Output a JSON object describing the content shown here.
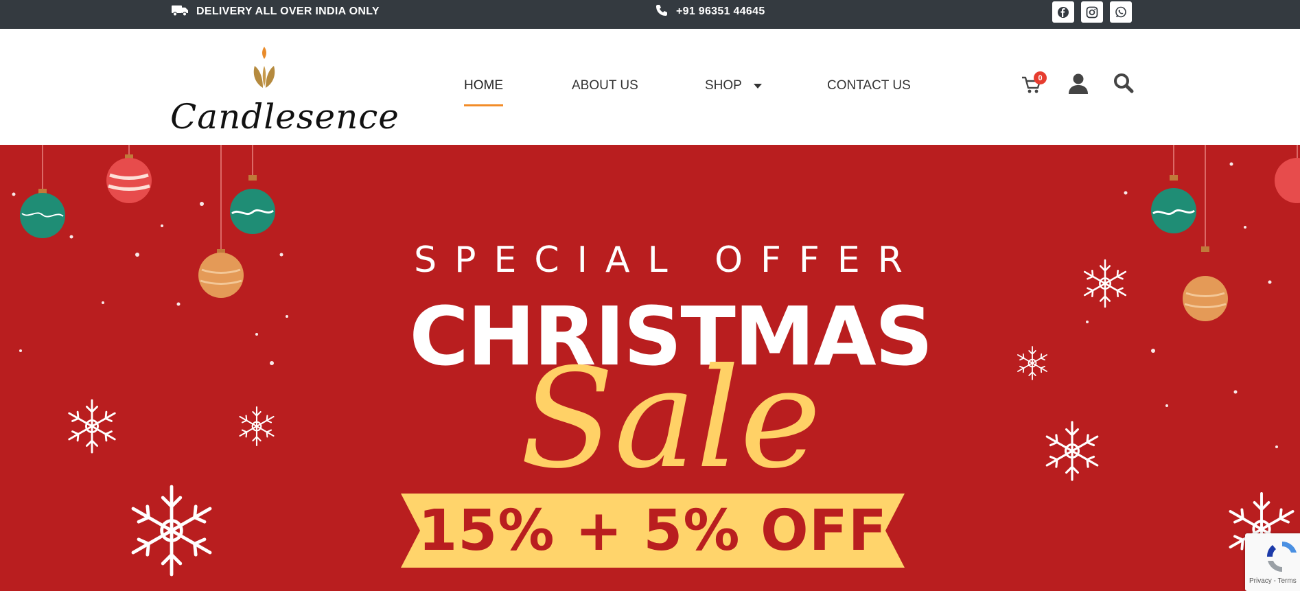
{
  "topbar": {
    "delivery_text": "DELIVERY ALL OVER INDIA ONLY",
    "delivery_icon": "truck-icon",
    "phone_text": "+91 96351 44645",
    "phone_icon": "phone-icon",
    "socials": [
      "facebook-icon",
      "instagram-icon",
      "whatsapp-icon"
    ]
  },
  "header": {
    "logo_text": "Candlesence",
    "nav": [
      {
        "label": "HOME",
        "active": true
      },
      {
        "label": "ABOUT US"
      },
      {
        "label": "SHOP",
        "has_dropdown": true
      },
      {
        "label": "CONTACT US"
      }
    ],
    "cart_count": "0",
    "icons": [
      "cart-icon",
      "user-icon",
      "search-icon"
    ]
  },
  "hero": {
    "line1": "SPECIAL OFFER",
    "line2": "CHRISTMAS",
    "line3": "Sale",
    "banner": "15% + 5% OFF"
  },
  "recaptcha": {
    "text": "Privacy - Terms"
  },
  "colors": {
    "topbar_bg": "#343a40",
    "hero_bg": "#b91e1f",
    "accent_orange": "#f28c28",
    "sale_yellow": "#ffd166",
    "badge_red": "#e63c2f"
  }
}
